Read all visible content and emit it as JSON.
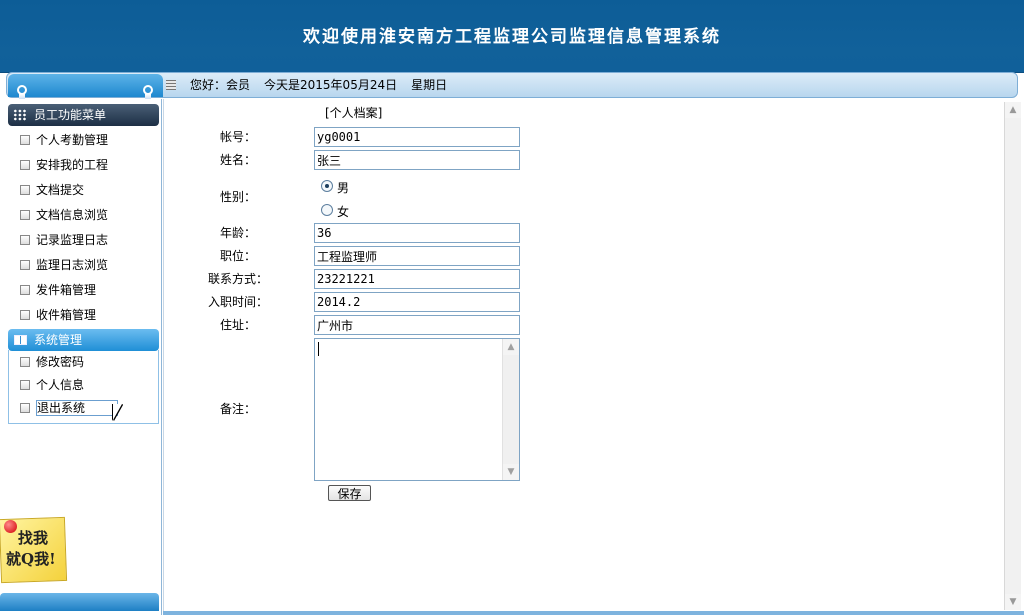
{
  "header": {
    "title": "欢迎使用淮安南方工程监理公司监理信息管理系统"
  },
  "topbar": {
    "greeting": "您好：会员",
    "date_text": "今天是2015年05月24日",
    "weekday": "星期日"
  },
  "sidebar": {
    "menu1_title": "员工功能菜单",
    "menu1_items": [
      {
        "label": "个人考勤管理"
      },
      {
        "label": "安排我的工程"
      },
      {
        "label": "文档提交"
      },
      {
        "label": "文档信息浏览"
      },
      {
        "label": "记录监理日志"
      },
      {
        "label": "监理日志浏览"
      },
      {
        "label": "发件箱管理"
      },
      {
        "label": "收件箱管理"
      }
    ],
    "menu2_title": "系统管理",
    "menu2_items": [
      {
        "label": "修改密码"
      },
      {
        "label": "个人信息"
      },
      {
        "label": "退出系统"
      }
    ],
    "qq_badge": {
      "line1": "找我",
      "line2": "就Q我!"
    }
  },
  "form": {
    "section_title": "[个人档案]",
    "account_label": "帐号：",
    "account_value": "yg0001",
    "name_label": "姓名：",
    "name_value": "张三",
    "gender_label": "性别：",
    "gender_options": [
      "男",
      "女"
    ],
    "gender_selected": "男",
    "age_label": "年龄：",
    "age_value": "36",
    "position_label": "职位：",
    "position_value": "工程监理师",
    "contact_label": "联系方式：",
    "contact_value": "23221221",
    "hire_date_label": "入职时间：",
    "hire_date_value": "2014.2",
    "address_label": "住址：",
    "address_value": "广州市",
    "notes_label": "备注：",
    "notes_value": "",
    "save_label": "保存"
  }
}
